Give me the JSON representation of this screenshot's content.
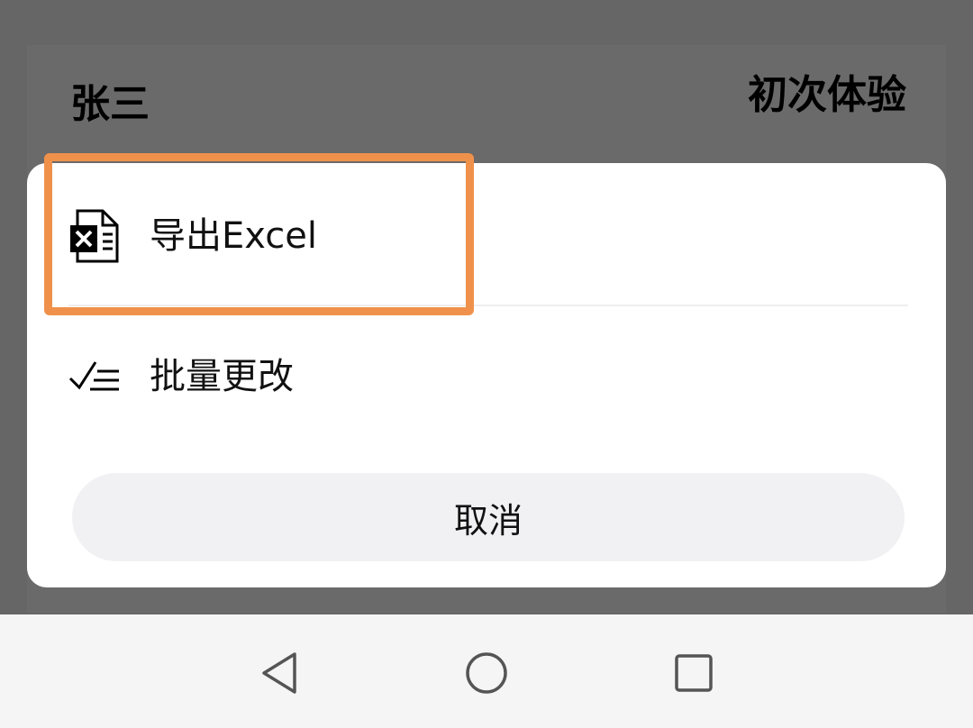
{
  "background": {
    "name": "张三",
    "status": "初次体验"
  },
  "sheet": {
    "items": [
      {
        "label": "导出Excel",
        "icon": "excel-file-icon"
      },
      {
        "label": "批量更改",
        "icon": "checklist-icon"
      }
    ],
    "cancel_label": "取消"
  },
  "navbar": {
    "icons": [
      "back-triangle-icon",
      "home-circle-icon",
      "recent-square-icon"
    ]
  },
  "colors": {
    "highlight": "#F0914B",
    "overlay": "#666666",
    "sheet": "#FFFFFF",
    "cancel_bg": "#F1F1F3",
    "navbar_bg": "#F5F5F5"
  }
}
